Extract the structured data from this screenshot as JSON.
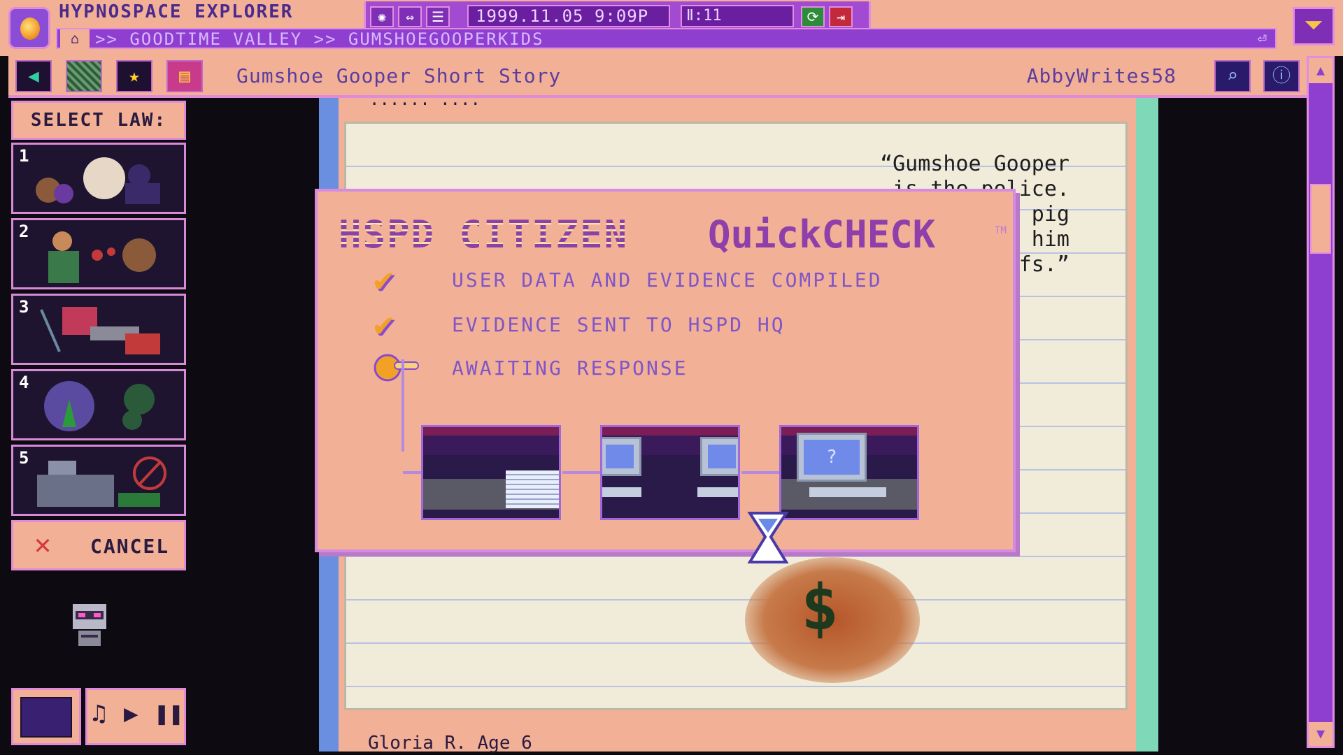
{
  "app": {
    "title": "HYPNOSPACE EXPLORER",
    "datetime": "1999.11.05    9:09P",
    "counter": "Ⅱ:11",
    "address": ">> GOODTIME VALLEY >> GUMSHOEGOOPERKIDS"
  },
  "toolbar": {
    "page_title": "Gumshoe Gooper Short Story",
    "author": "AbbyWrites58"
  },
  "left_panel": {
    "select_law_label": "SELECT LAW:",
    "laws": [
      {
        "num": "1"
      },
      {
        "num": "2"
      },
      {
        "num": "3"
      },
      {
        "num": "4"
      },
      {
        "num": "5"
      }
    ],
    "cancel_label": "CANCEL"
  },
  "page": {
    "top_snippet": "...... ....",
    "quote_lines": [
      "“Gumshoe Gooper",
      "is the police.",
      "e pig",
      "s him",
      "ffs.”"
    ],
    "footer_name": "Gloria R.    Age 6"
  },
  "dialog": {
    "title_part1": "HSPD CITIZEN",
    "title_part2": "QuickCHECK",
    "tm": "TM",
    "steps": [
      {
        "label": "USER DATA AND EVIDENCE COMPILED",
        "status": "done"
      },
      {
        "label": "EVIDENCE SENT TO HSPD HQ",
        "status": "done"
      },
      {
        "label": "AWAITING RESPONSE",
        "status": "pending"
      }
    ],
    "monitor_glyph": "?"
  },
  "icons": {
    "home": "home-icon",
    "back": "back-arrow-icon",
    "star": "star-icon",
    "search": "search-icon",
    "info": "info-icon",
    "refresh": "refresh-icon",
    "exit": "exit-icon"
  },
  "colors": {
    "peach": "#f2b196",
    "purple": "#8f3fd0",
    "pink_border": "#e08ad8",
    "check_orange": "#f2a127",
    "dialog_text": "#7f55c8"
  }
}
